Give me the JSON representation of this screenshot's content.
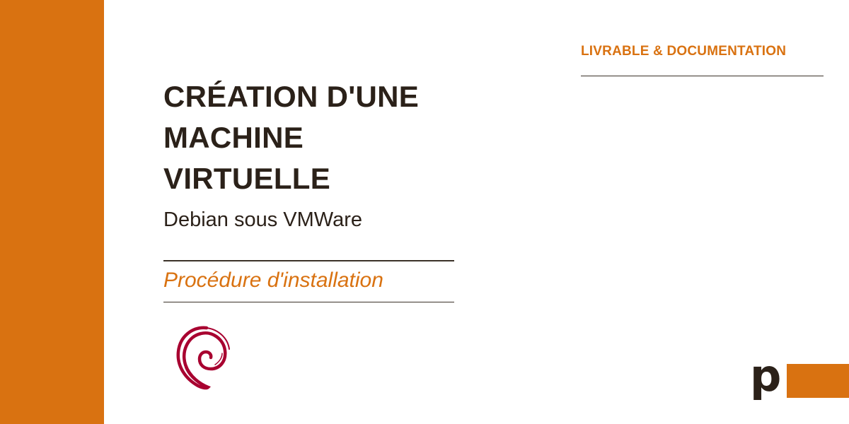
{
  "document": {
    "tag": "LIVRABLE & DOCUMENTATION",
    "title_lines": [
      "CRÉATION D'UNE",
      "MACHINE",
      "VIRTUELLE"
    ],
    "subtitle": "Debian sous VMWare",
    "procedure": "Procédure d'installation"
  },
  "brand": {
    "letter": "p"
  },
  "icons": {
    "debian_logo": "debian-swirl-logo"
  },
  "colors": {
    "accent": "#d97211",
    "text": "#2b2119",
    "debian": "#a80030"
  }
}
